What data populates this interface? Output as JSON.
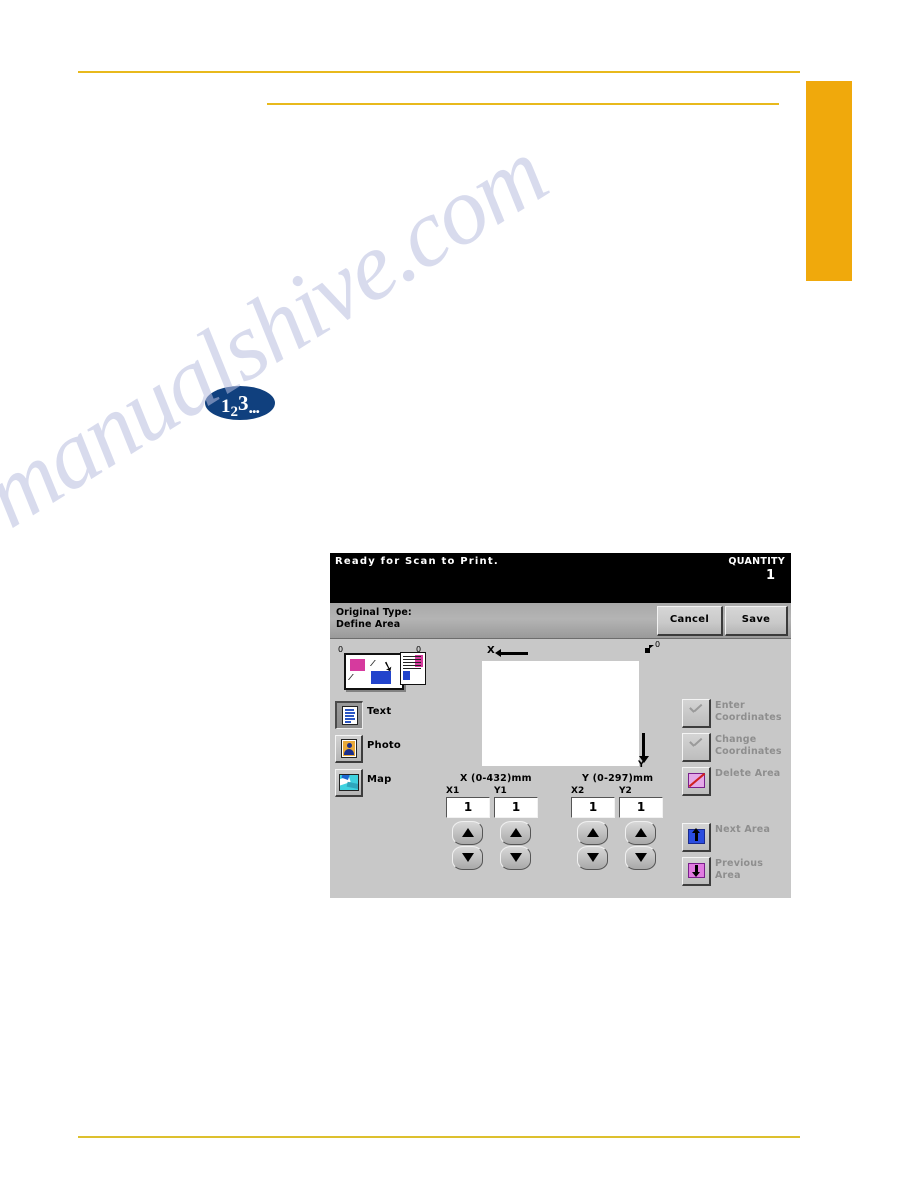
{
  "page": {
    "watermark": "manualshive.com",
    "accent_rule_color": "#e8b91c",
    "side_tab_color": "#f0a90c"
  },
  "step_badge": {
    "digit1": "1",
    "digit2": "2",
    "digit3": "3",
    "ellipsis": "...",
    "color": "#10407e"
  },
  "ui": {
    "status": {
      "message": "Ready  for  Scan  to  Print.",
      "quantity_label": "QUANTITY",
      "quantity_value": "1"
    },
    "titlebar": {
      "line1": "Original Type:",
      "line2": "Define Area",
      "cancel_label": "Cancel",
      "save_label": "Save"
    },
    "doc_illustration": {
      "zero_left": "0",
      "zero_right": "0"
    },
    "modes": [
      {
        "label": "Text",
        "icon": "text-icon",
        "selected": true
      },
      {
        "label": "Photo",
        "icon": "photo-icon",
        "selected": false
      },
      {
        "label": "Map",
        "icon": "map-icon",
        "selected": false
      }
    ],
    "preview": {
      "x_axis_label": "X",
      "y_axis_label": "Y",
      "origin_label": "0"
    },
    "coordinates": {
      "x_range_label": "X  (0-432)mm",
      "y_range_label": "Y  (0-297)mm",
      "fields": [
        {
          "tag": "X1",
          "value": "1"
        },
        {
          "tag": "Y1",
          "value": "1"
        },
        {
          "tag": "X2",
          "value": "1"
        },
        {
          "tag": "Y2",
          "value": "1"
        }
      ]
    },
    "actions": [
      {
        "label_line1": "Enter",
        "label_line2": "Coordinates",
        "icon": "check-icon",
        "enabled": false
      },
      {
        "label_line1": "Change",
        "label_line2": "Coordinates",
        "icon": "check-icon",
        "enabled": false
      },
      {
        "label_line1": "Delete  Area",
        "label_line2": "",
        "icon": "delete-area-icon",
        "enabled": false
      },
      {
        "label_line1": "Next  Area",
        "label_line2": "",
        "icon": "arrow-up-icon",
        "enabled": true
      },
      {
        "label_line1": "Previous",
        "label_line2": "Area",
        "icon": "arrow-down-icon",
        "enabled": true
      }
    ]
  }
}
